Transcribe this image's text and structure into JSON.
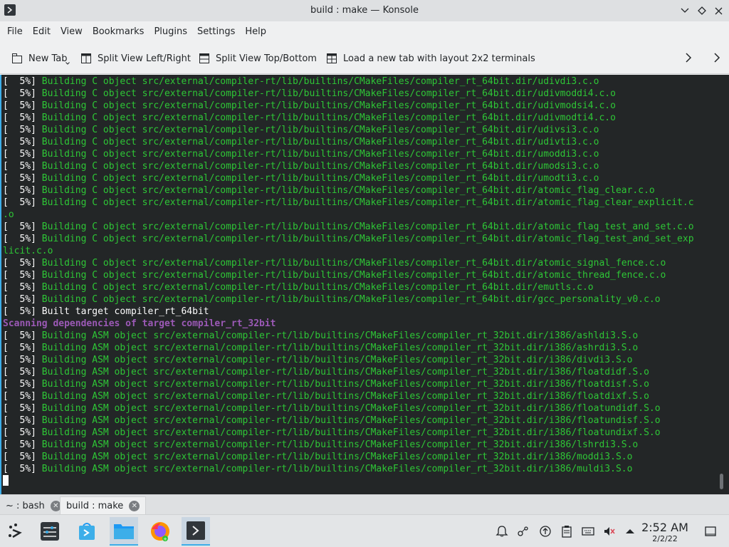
{
  "window": {
    "title": "build : make — Konsole"
  },
  "menu": [
    "File",
    "Edit",
    "View",
    "Bookmarks",
    "Plugins",
    "Settings",
    "Help"
  ],
  "toolbar": {
    "new_tab": "New Tab",
    "split_lr": "Split View Left/Right",
    "split_tb": "Split View Top/Bottom",
    "load_layout": "Load a new tab with layout 2x2 terminals"
  },
  "terminal": {
    "lines": [
      {
        "prefix": "[  5%] ",
        "text": "Building C object src/external/compiler-rt/lib/builtins/CMakeFiles/compiler_rt_64bit.dir/udivdi3.c.o",
        "style": "grn"
      },
      {
        "prefix": "[  5%] ",
        "text": "Building C object src/external/compiler-rt/lib/builtins/CMakeFiles/compiler_rt_64bit.dir/udivmoddi4.c.o",
        "style": "grn"
      },
      {
        "prefix": "[  5%] ",
        "text": "Building C object src/external/compiler-rt/lib/builtins/CMakeFiles/compiler_rt_64bit.dir/udivmodsi4.c.o",
        "style": "grn"
      },
      {
        "prefix": "[  5%] ",
        "text": "Building C object src/external/compiler-rt/lib/builtins/CMakeFiles/compiler_rt_64bit.dir/udivmodti4.c.o",
        "style": "grn"
      },
      {
        "prefix": "[  5%] ",
        "text": "Building C object src/external/compiler-rt/lib/builtins/CMakeFiles/compiler_rt_64bit.dir/udivsi3.c.o",
        "style": "grn"
      },
      {
        "prefix": "[  5%] ",
        "text": "Building C object src/external/compiler-rt/lib/builtins/CMakeFiles/compiler_rt_64bit.dir/udivti3.c.o",
        "style": "grn"
      },
      {
        "prefix": "[  5%] ",
        "text": "Building C object src/external/compiler-rt/lib/builtins/CMakeFiles/compiler_rt_64bit.dir/umoddi3.c.o",
        "style": "grn"
      },
      {
        "prefix": "[  5%] ",
        "text": "Building C object src/external/compiler-rt/lib/builtins/CMakeFiles/compiler_rt_64bit.dir/umodsi3.c.o",
        "style": "grn"
      },
      {
        "prefix": "[  5%] ",
        "text": "Building C object src/external/compiler-rt/lib/builtins/CMakeFiles/compiler_rt_64bit.dir/umodti3.c.o",
        "style": "grn"
      },
      {
        "prefix": "[  5%] ",
        "text": "Building C object src/external/compiler-rt/lib/builtins/CMakeFiles/compiler_rt_64bit.dir/atomic_flag_clear.c.o",
        "style": "grn"
      },
      {
        "prefix": "[  5%] ",
        "text": "Building C object src/external/compiler-rt/lib/builtins/CMakeFiles/compiler_rt_64bit.dir/atomic_flag_clear_explicit.c",
        "style": "grn"
      },
      {
        "prefix": "",
        "text": ".o",
        "style": "grn"
      },
      {
        "prefix": "[  5%] ",
        "text": "Building C object src/external/compiler-rt/lib/builtins/CMakeFiles/compiler_rt_64bit.dir/atomic_flag_test_and_set.c.o",
        "style": "grn"
      },
      {
        "prefix": "[  5%] ",
        "text": "Building C object src/external/compiler-rt/lib/builtins/CMakeFiles/compiler_rt_64bit.dir/atomic_flag_test_and_set_exp",
        "style": "grn"
      },
      {
        "prefix": "",
        "text": "licit.c.o",
        "style": "grn"
      },
      {
        "prefix": "[  5%] ",
        "text": "Building C object src/external/compiler-rt/lib/builtins/CMakeFiles/compiler_rt_64bit.dir/atomic_signal_fence.c.o",
        "style": "grn"
      },
      {
        "prefix": "[  5%] ",
        "text": "Building C object src/external/compiler-rt/lib/builtins/CMakeFiles/compiler_rt_64bit.dir/atomic_thread_fence.c.o",
        "style": "grn"
      },
      {
        "prefix": "[  5%] ",
        "text": "Building C object src/external/compiler-rt/lib/builtins/CMakeFiles/compiler_rt_64bit.dir/emutls.c.o",
        "style": "grn"
      },
      {
        "prefix": "[  5%] ",
        "text": "Building C object src/external/compiler-rt/lib/builtins/CMakeFiles/compiler_rt_64bit.dir/gcc_personality_v0.c.o",
        "style": "grn"
      },
      {
        "prefix": "[  5%] ",
        "text": "Built target compiler_rt_64bit",
        "style": "white"
      },
      {
        "prefix": "",
        "text": "Scanning dependencies of target compiler_rt_32bit",
        "style": "purple"
      },
      {
        "prefix": "[  5%] ",
        "text": "Building ASM object src/external/compiler-rt/lib/builtins/CMakeFiles/compiler_rt_32bit.dir/i386/ashldi3.S.o",
        "style": "grn"
      },
      {
        "prefix": "[  5%] ",
        "text": "Building ASM object src/external/compiler-rt/lib/builtins/CMakeFiles/compiler_rt_32bit.dir/i386/ashrdi3.S.o",
        "style": "grn"
      },
      {
        "prefix": "[  5%] ",
        "text": "Building ASM object src/external/compiler-rt/lib/builtins/CMakeFiles/compiler_rt_32bit.dir/i386/divdi3.S.o",
        "style": "grn"
      },
      {
        "prefix": "[  5%] ",
        "text": "Building ASM object src/external/compiler-rt/lib/builtins/CMakeFiles/compiler_rt_32bit.dir/i386/floatdidf.S.o",
        "style": "grn"
      },
      {
        "prefix": "[  5%] ",
        "text": "Building ASM object src/external/compiler-rt/lib/builtins/CMakeFiles/compiler_rt_32bit.dir/i386/floatdisf.S.o",
        "style": "grn"
      },
      {
        "prefix": "[  5%] ",
        "text": "Building ASM object src/external/compiler-rt/lib/builtins/CMakeFiles/compiler_rt_32bit.dir/i386/floatdixf.S.o",
        "style": "grn"
      },
      {
        "prefix": "[  5%] ",
        "text": "Building ASM object src/external/compiler-rt/lib/builtins/CMakeFiles/compiler_rt_32bit.dir/i386/floatundidf.S.o",
        "style": "grn"
      },
      {
        "prefix": "[  5%] ",
        "text": "Building ASM object src/external/compiler-rt/lib/builtins/CMakeFiles/compiler_rt_32bit.dir/i386/floatundisf.S.o",
        "style": "grn"
      },
      {
        "prefix": "[  5%] ",
        "text": "Building ASM object src/external/compiler-rt/lib/builtins/CMakeFiles/compiler_rt_32bit.dir/i386/floatundixf.S.o",
        "style": "grn"
      },
      {
        "prefix": "[  5%] ",
        "text": "Building ASM object src/external/compiler-rt/lib/builtins/CMakeFiles/compiler_rt_32bit.dir/i386/lshrdi3.S.o",
        "style": "grn"
      },
      {
        "prefix": "[  5%] ",
        "text": "Building ASM object src/external/compiler-rt/lib/builtins/CMakeFiles/compiler_rt_32bit.dir/i386/moddi3.S.o",
        "style": "grn"
      },
      {
        "prefix": "[  5%] ",
        "text": "Building ASM object src/external/compiler-rt/lib/builtins/CMakeFiles/compiler_rt_32bit.dir/i386/muldi3.S.o",
        "style": "grn"
      }
    ]
  },
  "tabs": [
    {
      "label": "~ : bash",
      "active": false
    },
    {
      "label": "build : make",
      "active": true
    }
  ],
  "taskbar": {
    "clock_time": "2:52 AM",
    "clock_date": "2/2/22",
    "apps": [
      "application-launcher-icon",
      "system-settings-icon",
      "discover-icon",
      "file-manager-icon",
      "firefox-icon",
      "konsole-icon"
    ]
  },
  "colors": {
    "terminal_bg": "#232627",
    "green_text": "#2ec636",
    "purple_text": "#9b59b6",
    "accent": "#3daee9"
  }
}
